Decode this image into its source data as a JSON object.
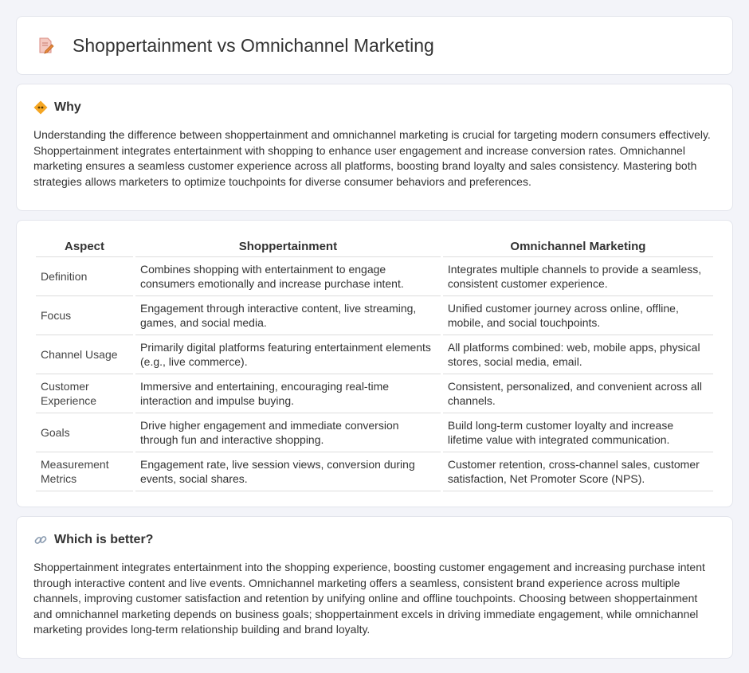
{
  "page": {
    "title": "Shoppertainment vs Omnichannel Marketing",
    "icon": "document-pencil-icon"
  },
  "why": {
    "heading": "Why",
    "icon": "diamond-warning-icon",
    "text": "Understanding the difference between shoppertainment and omnichannel marketing is crucial for targeting modern consumers effectively. Shoppertainment integrates entertainment with shopping to enhance user engagement and increase conversion rates. Omnichannel marketing ensures a seamless customer experience across all platforms, boosting brand loyalty and sales consistency. Mastering both strategies allows marketers to optimize touchpoints for diverse consumer behaviors and preferences."
  },
  "table": {
    "headers": [
      "Aspect",
      "Shoppertainment",
      "Omnichannel Marketing"
    ],
    "rows": [
      [
        "Definition",
        "Combines shopping with entertainment to engage consumers emotionally and increase purchase intent.",
        "Integrates multiple channels to provide a seamless, consistent customer experience."
      ],
      [
        "Focus",
        "Engagement through interactive content, live streaming, games, and social media.",
        "Unified customer journey across online, offline, mobile, and social touchpoints."
      ],
      [
        "Channel Usage",
        "Primarily digital platforms featuring entertainment elements (e.g., live commerce).",
        "All platforms combined: web, mobile apps, physical stores, social media, email."
      ],
      [
        "Customer Experience",
        "Immersive and entertaining, encouraging real-time interaction and impulse buying.",
        "Consistent, personalized, and convenient across all channels."
      ],
      [
        "Goals",
        "Drive higher engagement and immediate conversion through fun and interactive shopping.",
        "Build long-term customer loyalty and increase lifetime value with integrated communication."
      ],
      [
        "Measurement Metrics",
        "Engagement rate, live session views, conversion during events, social shares.",
        "Customer retention, cross-channel sales, customer satisfaction, Net Promoter Score (NPS)."
      ]
    ]
  },
  "better": {
    "heading": "Which is better?",
    "icon": "link-icon",
    "text": "Shoppertainment integrates entertainment into the shopping experience, boosting customer engagement and increasing purchase intent through interactive content and live events. Omnichannel marketing offers a seamless, consistent brand experience across multiple channels, improving customer satisfaction and retention by unifying online and offline touchpoints. Choosing between shoppertainment and omnichannel marketing depends on business goals; shoppertainment excels in driving immediate engagement, while omnichannel marketing provides long-term relationship building and brand loyalty."
  }
}
